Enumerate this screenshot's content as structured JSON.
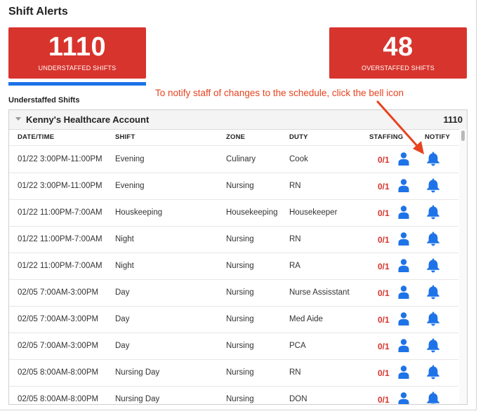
{
  "page": {
    "title": "Shift Alerts"
  },
  "stats": {
    "understaffed": {
      "count": "1110",
      "label": "UNDERSTAFFED SHIFTS"
    },
    "overstaffed": {
      "count": "48",
      "label": "OVERSTAFFED SHIFTS"
    }
  },
  "section_label": "Understaffed Shifts",
  "annotation": "To notify staff of changes to the schedule, click the bell icon",
  "account": {
    "name": "Kenny's Healthcare Account",
    "count": "1110"
  },
  "columns": {
    "datetime": "DATE/TIME",
    "shift": "SHIFT",
    "zone": "ZONE",
    "duty": "DUTY",
    "staffing": "STAFFING",
    "notify": "NOTIFY"
  },
  "colors": {
    "accent_red": "#d7342d",
    "accent_blue": "#1e73e8",
    "annotation": "#e8421f"
  },
  "icons": {
    "person": "person-icon",
    "bell": "bell-icon",
    "caret": "caret-down-icon"
  },
  "rows": [
    {
      "datetime": "01/22 3:00PM-11:00PM",
      "shift": "Evening",
      "zone": "Culinary",
      "duty": "Cook",
      "staffing": "0/1"
    },
    {
      "datetime": "01/22 3:00PM-11:00PM",
      "shift": "Evening",
      "zone": "Nursing",
      "duty": "RN",
      "staffing": "0/1"
    },
    {
      "datetime": "01/22 11:00PM-7:00AM",
      "shift": "Houskeeping",
      "zone": "Housekeeping",
      "duty": "Housekeeper",
      "staffing": "0/1"
    },
    {
      "datetime": "01/22 11:00PM-7:00AM",
      "shift": "Night",
      "zone": "Nursing",
      "duty": "RN",
      "staffing": "0/1"
    },
    {
      "datetime": "01/22 11:00PM-7:00AM",
      "shift": "Night",
      "zone": "Nursing",
      "duty": "RA",
      "staffing": "0/1"
    },
    {
      "datetime": "02/05 7:00AM-3:00PM",
      "shift": "Day",
      "zone": "Nursing",
      "duty": "Nurse Assisstant",
      "staffing": "0/1"
    },
    {
      "datetime": "02/05 7:00AM-3:00PM",
      "shift": "Day",
      "zone": "Nursing",
      "duty": "Med Aide",
      "staffing": "0/1"
    },
    {
      "datetime": "02/05 7:00AM-3:00PM",
      "shift": "Day",
      "zone": "Nursing",
      "duty": "PCA",
      "staffing": "0/1"
    },
    {
      "datetime": "02/05 8:00AM-8:00PM",
      "shift": "Nursing Day",
      "zone": "Nursing",
      "duty": "RN",
      "staffing": "0/1"
    },
    {
      "datetime": "02/05 8:00AM-8:00PM",
      "shift": "Nursing Day",
      "zone": "Nursing",
      "duty": "DON",
      "staffing": "0/1"
    }
  ]
}
